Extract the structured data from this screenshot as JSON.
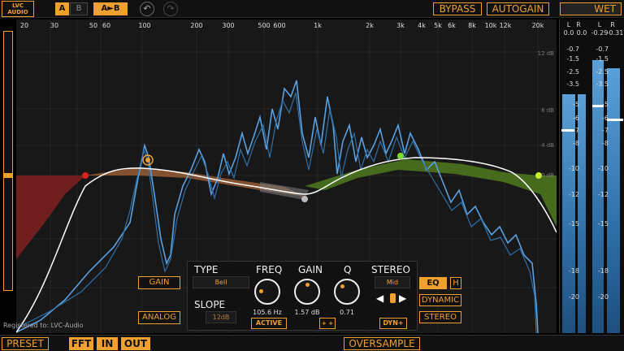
{
  "header": {
    "logo_line1": "LVC",
    "logo_line2": "AUDIO",
    "ab_a": "A",
    "ab_b": "B",
    "ab_copy": "A►B",
    "undo_icon": "undo-icon",
    "redo_icon": "redo-icon",
    "bypass": "BYPASS",
    "autogain": "AUTOGAIN",
    "wet": "WET"
  },
  "freq_labels": [
    {
      "text": "20"
    },
    {
      "text": "30"
    },
    {
      "text": "50"
    },
    {
      "text": "60"
    },
    {
      "text": "100"
    },
    {
      "text": "200"
    },
    {
      "text": "300"
    },
    {
      "text": "500"
    },
    {
      "text": "600"
    },
    {
      "text": "1k"
    },
    {
      "text": "2k"
    },
    {
      "text": "3k"
    },
    {
      "text": "4k"
    },
    {
      "text": "5k"
    },
    {
      "text": "6k"
    },
    {
      "text": "8k"
    },
    {
      "text": "10k"
    },
    {
      "text": "12k"
    },
    {
      "text": "20k"
    }
  ],
  "db_labels": [
    "12 dB",
    "8 dB",
    "4 dB",
    "0 dB"
  ],
  "side_buttons": {
    "gain": "GAIN",
    "analog": "ANALOG"
  },
  "band_panel": {
    "type_label": "TYPE",
    "type_value": "Bell",
    "slope_label": "SLOPE",
    "slope_value": "12dB",
    "freq_label": "FREQ",
    "freq_value": "105.6 Hz",
    "gain_label": "GAIN",
    "gain_value": "1.57 dB",
    "q_label": "Q",
    "q_value": "0.71",
    "stereo_label": "STEREO",
    "stereo_value": "Mid",
    "active": "ACTIVE",
    "plus_plus": "+ +",
    "dyn_plus": "DYN+",
    "eq": "EQ",
    "h": "H",
    "dynamic": "DYNAMIC",
    "stereo": "STEREO"
  },
  "footer": {
    "registered": "Registered to: LVC-Audio",
    "preset": "PRESET",
    "fft": "FFT",
    "in": "IN",
    "out": "OUT",
    "oversample": "OVERSAMPLE"
  },
  "output_meter": {
    "left_label": "L",
    "right_label": "R",
    "in_l": "0.0",
    "in_r": "0.0",
    "out_l": "-0.29",
    "out_r": "-0.31",
    "scale": [
      "-0.7",
      "-1.5",
      "-2.5",
      "-3.5",
      "-5",
      "-6",
      "-7",
      "-8",
      "-10",
      "-12",
      "-15",
      "-18",
      "-20"
    ]
  },
  "colors": {
    "accent": "#f0a030",
    "spectrum": "#5aa0e0",
    "band_low": "#c43030",
    "band_mid": "#6fa028",
    "curve": "#ffffff"
  }
}
